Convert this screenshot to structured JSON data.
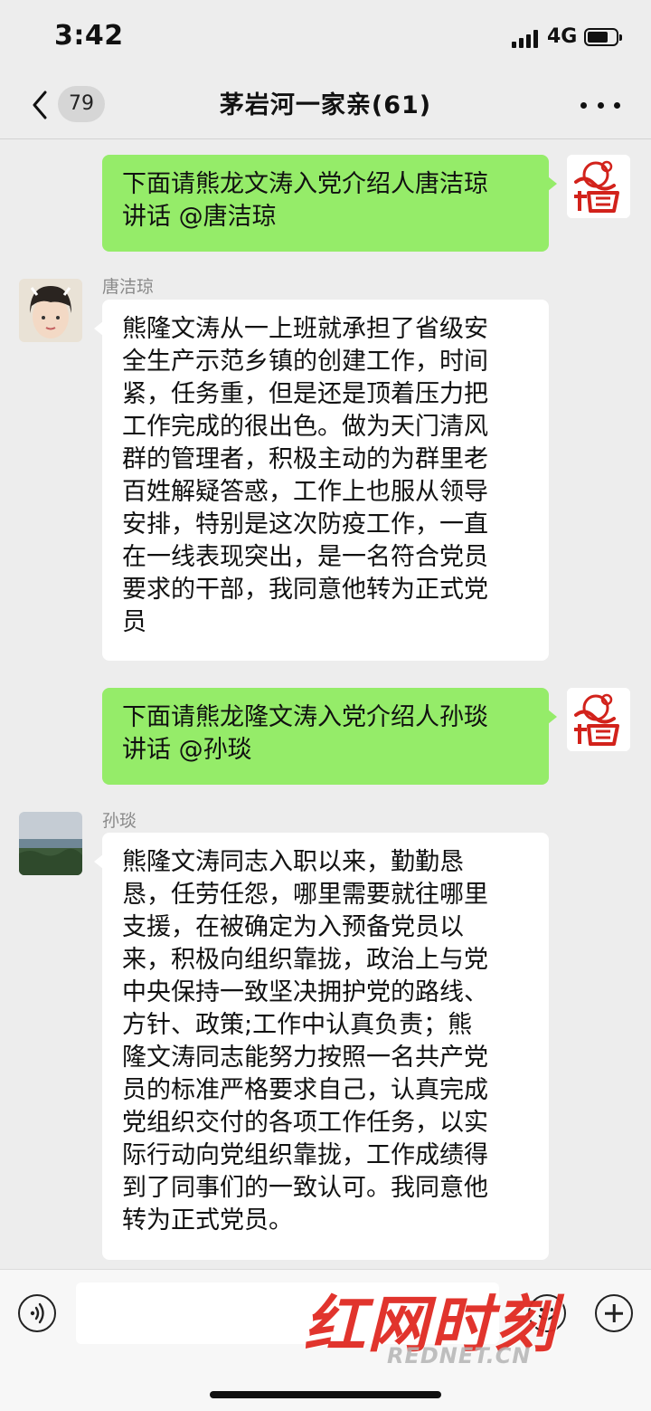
{
  "status_bar": {
    "time": "3:42",
    "network": "4G"
  },
  "nav": {
    "back_count": "79",
    "title": "茅岩河一家亲(61)"
  },
  "messages": [
    {
      "type": "out",
      "text": "下面请熊龙文涛入党介绍人唐洁琼\n讲话 @唐洁琼"
    },
    {
      "type": "in",
      "sender": "唐洁琼",
      "text": "熊隆文涛从一上班就承担了省级安\n全生产示范乡镇的创建工作，时间\n紧，任务重，但是还是顶着压力把\n工作完成的很出色。做为天门清风\n群的管理者，积极主动的为群里老\n百姓解疑答惑，工作上也服从领导\n安排，特别是这次防疫工作，一直\n在一线表现突出，是一名符合党员\n要求的干部，我同意他转为正式党\n员"
    },
    {
      "type": "out",
      "text": "下面请熊龙隆文涛入党介绍人孙琰\n讲话 @孙琰"
    },
    {
      "type": "in",
      "sender": "孙琰",
      "text": "熊隆文涛同志入职以来，勤勤恳\n恳，任劳任怨，哪里需要就往哪里\n支援，在被确定为入预备党员以\n来，积极向组织靠拢，政治上与党\n中央保持一致坚决拥护党的路线、\n方针、政策;工作中认真负责；熊\n隆文涛同志能努力按照一名共产党\n员的标准严格要求自己，认真完成\n党组织交付的各项工作任务，以实\n际行动向党组织靠拢，工作成绩得\n到了同事们的一致认可。我同意他\n转为正式党员。"
    }
  ],
  "watermark": {
    "main": "红网时刻",
    "sub": "REDNET.CN"
  },
  "colors": {
    "outgoing_bubble": "#95ec69",
    "incoming_bubble": "#ffffff",
    "background": "#ededed",
    "watermark_red": "#e02a22"
  },
  "icons": [
    "signal-icon",
    "battery-icon",
    "back-chevron-icon",
    "more-dots-icon",
    "voice-icon",
    "emoji-icon",
    "plus-icon"
  ]
}
